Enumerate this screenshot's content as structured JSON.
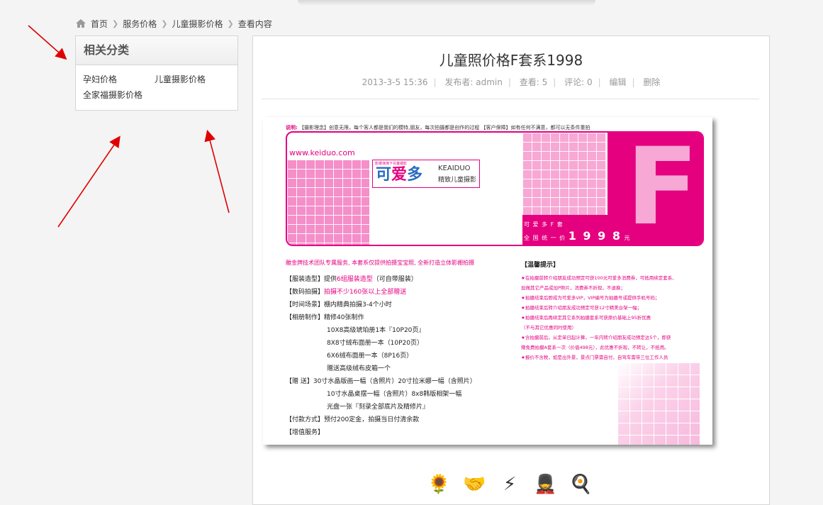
{
  "breadcrumb": {
    "items": [
      "首页",
      "服务价格",
      "儿童摄影价格",
      "查看内容"
    ]
  },
  "sidebar": {
    "title": "相关分类",
    "categories": [
      "孕妇价格",
      "儿童摄影价格",
      "全家福摄影价格"
    ]
  },
  "article": {
    "title": "儿童照价格F套系1998",
    "date": "2013-3-5 15:36",
    "author": "发布者: admin",
    "views": "查看: 5",
    "comments": "评论: 0",
    "edit": "编辑",
    "delete": "删除"
  },
  "poster": {
    "top_note_label": "说明:",
    "top_note": "【摄影理念】创意无限，每个客人都是我们的模特,朋友，每次拍摄都是创作的过程    【客户保障】如有任何不满意，都可以无条件重拍",
    "website": "www.keiduo.com",
    "logo_small": "影楼演演下兑童摄影",
    "logo_big_a": "可",
    "logo_big_b": "爱",
    "logo_big_c": "多",
    "logo_en": "KEAIDUO",
    "logo_cn": "精致儿童摄影",
    "big_letter": "F",
    "price_line1": "可 爱 多 F 套",
    "price_line2_prefix": "全 国 统 一 价",
    "price_value": "1 9 9 8",
    "price_unit": "元",
    "headline": "雕金牌技术团队专属服务, 本套系仅提供拍摄宝宝照, 全新打造立体影棚拍摄",
    "lines": [
      {
        "label": "【服装造型】",
        "text_plain": "提供",
        "text_pink": "6组服装造型",
        "text_after": "（可自带服装）",
        "indent": false
      },
      {
        "label": "【数码拍摄】",
        "text_plain": "",
        "text_pink": "拍摄不少160张以上全部赠送",
        "text_after": "",
        "indent": false
      },
      {
        "label": "【时间场景】",
        "text_plain": "棚内精典拍摄3-4个小时",
        "text_pink": "",
        "text_after": "",
        "indent": false
      },
      {
        "label": "【相册制作】",
        "text_plain": "精修40张制作",
        "text_pink": "",
        "text_after": "",
        "indent": false
      },
      {
        "label": "",
        "text_plain": "10X8高级琥珀册1本『10P20页』",
        "text_pink": "",
        "text_after": "",
        "indent": true
      },
      {
        "label": "",
        "text_plain": "8X8寸绒布面册一本（10P20页）",
        "text_pink": "",
        "text_after": "",
        "indent": true
      },
      {
        "label": "",
        "text_plain": "6X6绒布面册一本（8P16页）",
        "text_pink": "",
        "text_after": "",
        "indent": true
      },
      {
        "label": "",
        "text_plain": "赠送高级绒布皮箱一个",
        "text_pink": "",
        "text_after": "",
        "indent": true
      },
      {
        "label": "【赠      送】",
        "text_plain": "30寸水晶版画一幅（含照片）20寸拉米娜一幅（含照片）",
        "text_pink": "",
        "text_after": "",
        "indent": false
      },
      {
        "label": "",
        "text_plain": "10寸水晶桌摆一幅（含照片）8x8韩版相架一幅",
        "text_pink": "",
        "text_after": "",
        "indent": true
      },
      {
        "label": "",
        "text_plain": "光盘一张『刻录全部底片及精修片』",
        "text_pink": "",
        "text_after": "",
        "indent": true
      },
      {
        "label": "【付款方式】",
        "text_plain": "预付200定金，拍摄当日付清余款",
        "text_pink": "",
        "text_after": "",
        "indent": false
      },
      {
        "label": "【增值服务】",
        "text_plain": "",
        "text_pink": "",
        "text_after": "",
        "indent": false
      }
    ],
    "tips_title": "【温馨提示】",
    "tips": [
      "★在拍摄前转介绍朋友成功预定可获100元可爱多消费券，可抵用续定套系、",
      "  加做其它产品或加P照片，消费券不折现，不退换；",
      "★拍摄结束后即成为可爱多VIP，VIP编号为拍摄号或提供手机号码；",
      "★拍摄结束后转介绍朋友成功预定可获12寸精美台架一幅；",
      "★拍摄结束后再续定其它系列拍摄套系可获原价基础上95折优惠",
      "  （不与其它优惠同时使用）",
      "★含拍摄前后，从定单日起计算，一年内转介绍朋友成功预定达5个，即获",
      "  赠免费拍摄A套系一次（价值498元），此优惠不折现，不转让，不抵用。",
      "★报价不含税，如是出外景，景点门票需自付，自驾车需带三位工作人员"
    ]
  },
  "emoticons": [
    "flower-icon",
    "handshake-icon",
    "lightning-icon",
    "soldier-icon",
    "egg-icon"
  ]
}
